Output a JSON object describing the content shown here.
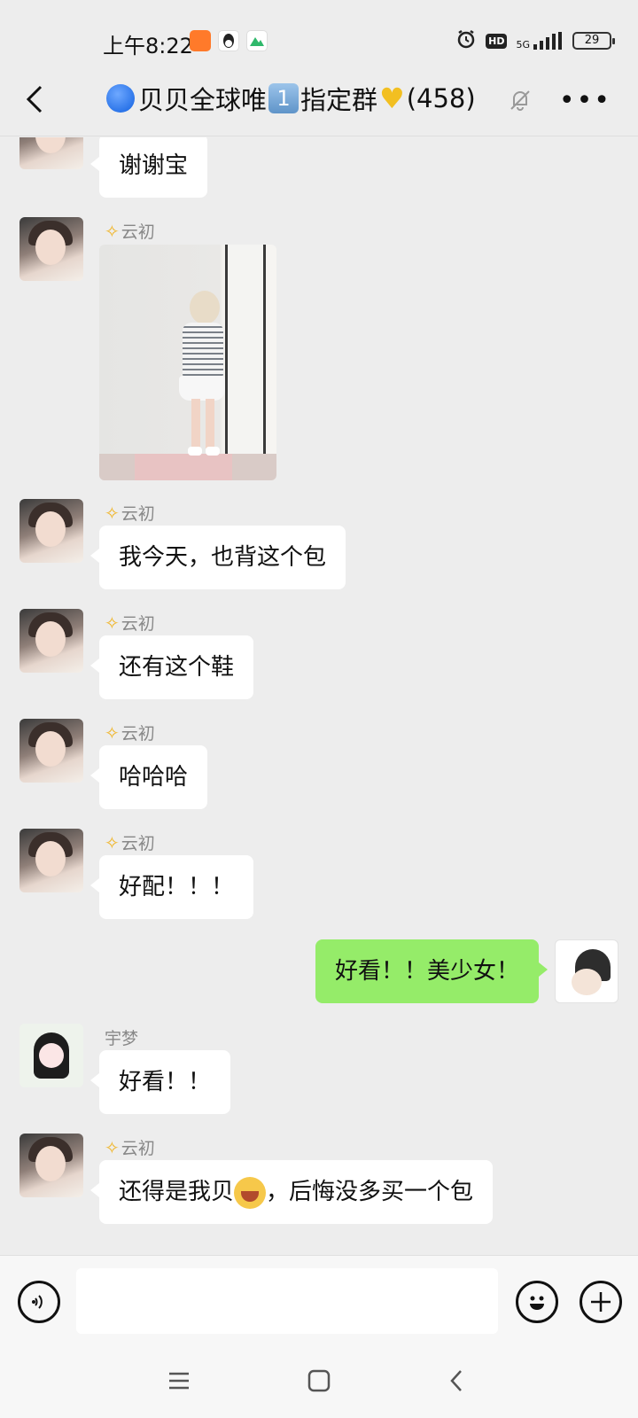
{
  "status_bar": {
    "time": "上午8:22",
    "network": "5G",
    "hd_badge": "HD",
    "battery": "29",
    "icons": [
      "alarm-icon",
      "hd-icon",
      "signal-icon",
      "battery-icon"
    ]
  },
  "header": {
    "title_part1": "贝贝全球唯",
    "title_number": "1",
    "title_part2": "指定群",
    "member_count": "(458)",
    "icons": [
      "back-icon",
      "mute-bell-icon",
      "more-icon"
    ]
  },
  "messages": [
    {
      "type": "text",
      "side": "left",
      "sender": "",
      "text": "谢谢宝"
    },
    {
      "type": "image",
      "side": "left",
      "sender": "云初",
      "alt": "photo"
    },
    {
      "type": "text",
      "side": "left",
      "sender": "云初",
      "text": "我今天，也背这个包"
    },
    {
      "type": "text",
      "side": "left",
      "sender": "云初",
      "text": "还有这个鞋"
    },
    {
      "type": "text",
      "side": "left",
      "sender": "云初",
      "text": "哈哈哈"
    },
    {
      "type": "text",
      "side": "left",
      "sender": "云初",
      "text": "好配！！！"
    },
    {
      "type": "text",
      "side": "right",
      "sender": "",
      "text": "好看！！美少女！"
    },
    {
      "type": "text",
      "side": "left",
      "sender": "宇梦",
      "text": "好看！！"
    },
    {
      "type": "text",
      "side": "left",
      "sender": "云初",
      "text_before": "还得是我贝",
      "text_after": "，后悔没多买一个包"
    }
  ],
  "input_bar": {
    "value": "",
    "icons": [
      "voice-icon",
      "emoji-icon",
      "plus-icon"
    ]
  },
  "nav_bar": {
    "icons": [
      "menu-icon",
      "home-icon",
      "back-nav-icon"
    ]
  },
  "colors": {
    "background": "#ededed",
    "my_bubble": "#95ec69",
    "other_bubble": "#ffffff"
  }
}
